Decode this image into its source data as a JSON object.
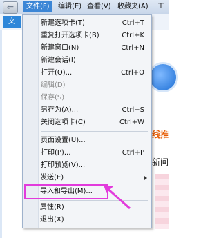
{
  "menubar": {
    "back_glyph": "⇐",
    "menus": [
      "文件(F)",
      "编辑(E)",
      "查看(V)",
      "收藏夹(A)",
      "工"
    ]
  },
  "tab": {
    "label": "文"
  },
  "background": {
    "orange_text": "线推",
    "dark_text": "新间"
  },
  "dropdown": {
    "items": [
      {
        "label": "新建选项卡(T)",
        "shortcut": "Ctrl+T"
      },
      {
        "label": "重复打开选项卡(B)",
        "shortcut": "Ctrl+K"
      },
      {
        "label": "新建窗口(N)",
        "shortcut": "Ctrl+N"
      },
      {
        "label": "新建会话(I)",
        "shortcut": ""
      },
      {
        "label": "打开(O)...",
        "shortcut": "Ctrl+O"
      },
      {
        "label": "编辑(D)",
        "shortcut": ""
      },
      {
        "label": "保存(S)",
        "shortcut": ""
      },
      {
        "label": "另存为(A)...",
        "shortcut": "Ctrl+S"
      },
      {
        "label": "关闭选项卡(C)",
        "shortcut": "Ctrl+W"
      },
      {
        "label": "页面设置(U)...",
        "shortcut": ""
      },
      {
        "label": "打印(P)...",
        "shortcut": "Ctrl+P"
      },
      {
        "label": "打印预览(V)...",
        "shortcut": ""
      },
      {
        "label": "发送(E)",
        "shortcut": ""
      },
      {
        "label": "导入和导出(M)...",
        "shortcut": ""
      },
      {
        "label": "属性(R)",
        "shortcut": ""
      },
      {
        "label": "退出(X)",
        "shortcut": ""
      }
    ]
  },
  "colors": {
    "highlight": "#e23bdc",
    "active_menu": "#3c86d6"
  }
}
